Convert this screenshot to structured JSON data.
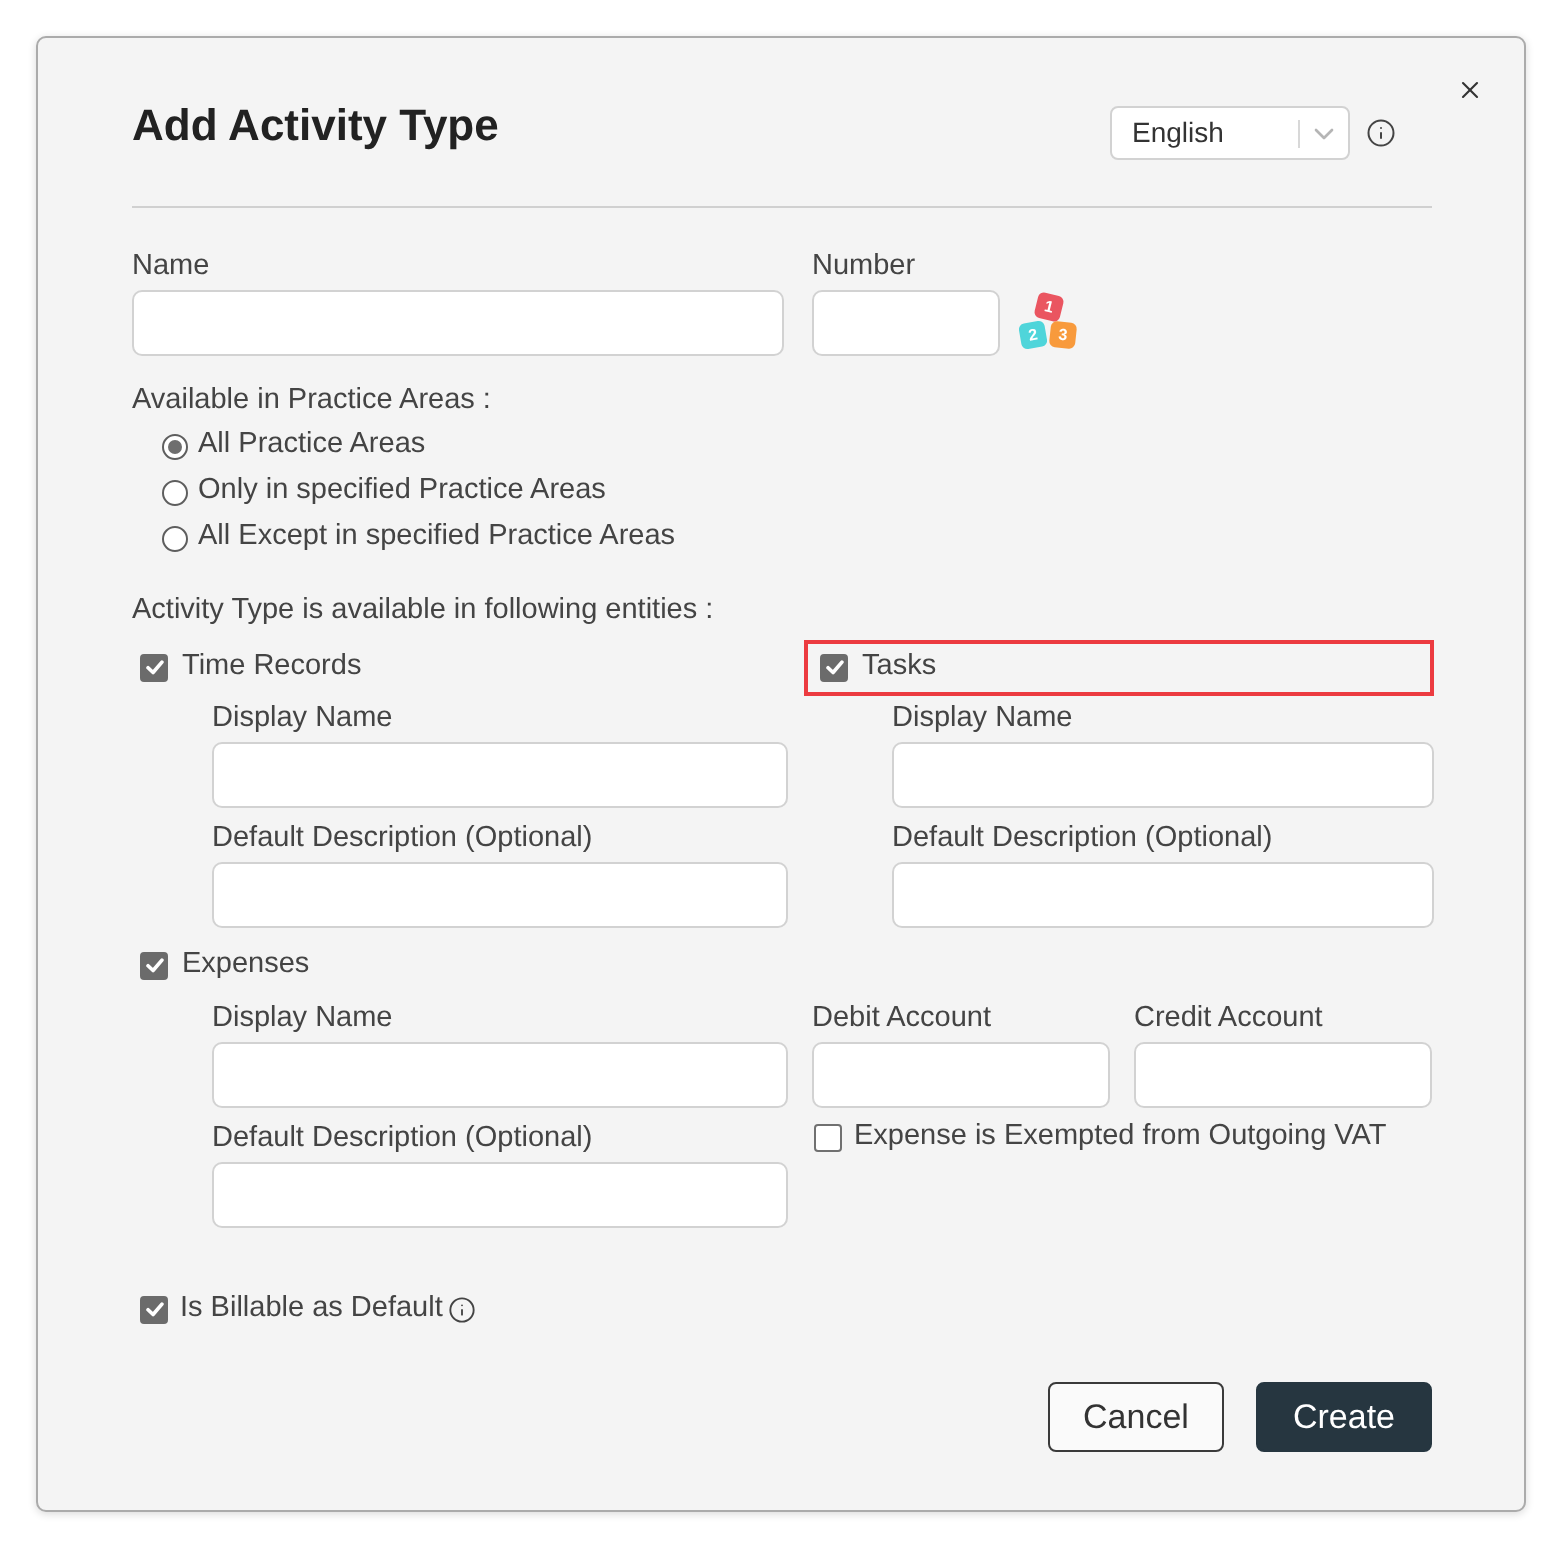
{
  "dialog": {
    "title": "Add Activity Type",
    "language_select": {
      "value": "English"
    }
  },
  "name_field": {
    "label": "Name"
  },
  "number_field": {
    "label": "Number",
    "generator_digits": [
      "1",
      "2",
      "3"
    ]
  },
  "practice_areas": {
    "label": "Available in Practice Areas :",
    "options": [
      {
        "label": "All Practice Areas",
        "selected": true
      },
      {
        "label": "Only in specified Practice Areas",
        "selected": false
      },
      {
        "label": "All Except in specified Practice Areas",
        "selected": false
      }
    ]
  },
  "entities": {
    "label": "Activity Type is available in following entities :",
    "items": [
      {
        "kind": "standard",
        "label": "Time Records",
        "checked": true,
        "highlighted": false,
        "fields": [
          {
            "label": "Display Name"
          },
          {
            "label": "Default Description (Optional)"
          }
        ]
      },
      {
        "kind": "standard",
        "label": "Tasks",
        "checked": true,
        "highlighted": true,
        "fields": [
          {
            "label": "Display Name"
          },
          {
            "label": "Default Description (Optional)"
          }
        ]
      },
      {
        "kind": "expense",
        "label": "Expenses",
        "checked": true,
        "highlighted": false,
        "fields": [
          {
            "label": "Display Name"
          },
          {
            "label": "Default Description (Optional)"
          }
        ],
        "accounts": [
          {
            "label": "Debit Account"
          },
          {
            "label": "Credit Account"
          }
        ],
        "vat_exempt": {
          "label": "Expense is Exempted from Outgoing VAT",
          "checked": false
        }
      }
    ]
  },
  "billable": {
    "label": "Is Billable as Default",
    "checked": true
  },
  "buttons": [
    {
      "label": "Cancel",
      "kind": "secondary"
    },
    {
      "label": "Create",
      "kind": "primary"
    }
  ]
}
